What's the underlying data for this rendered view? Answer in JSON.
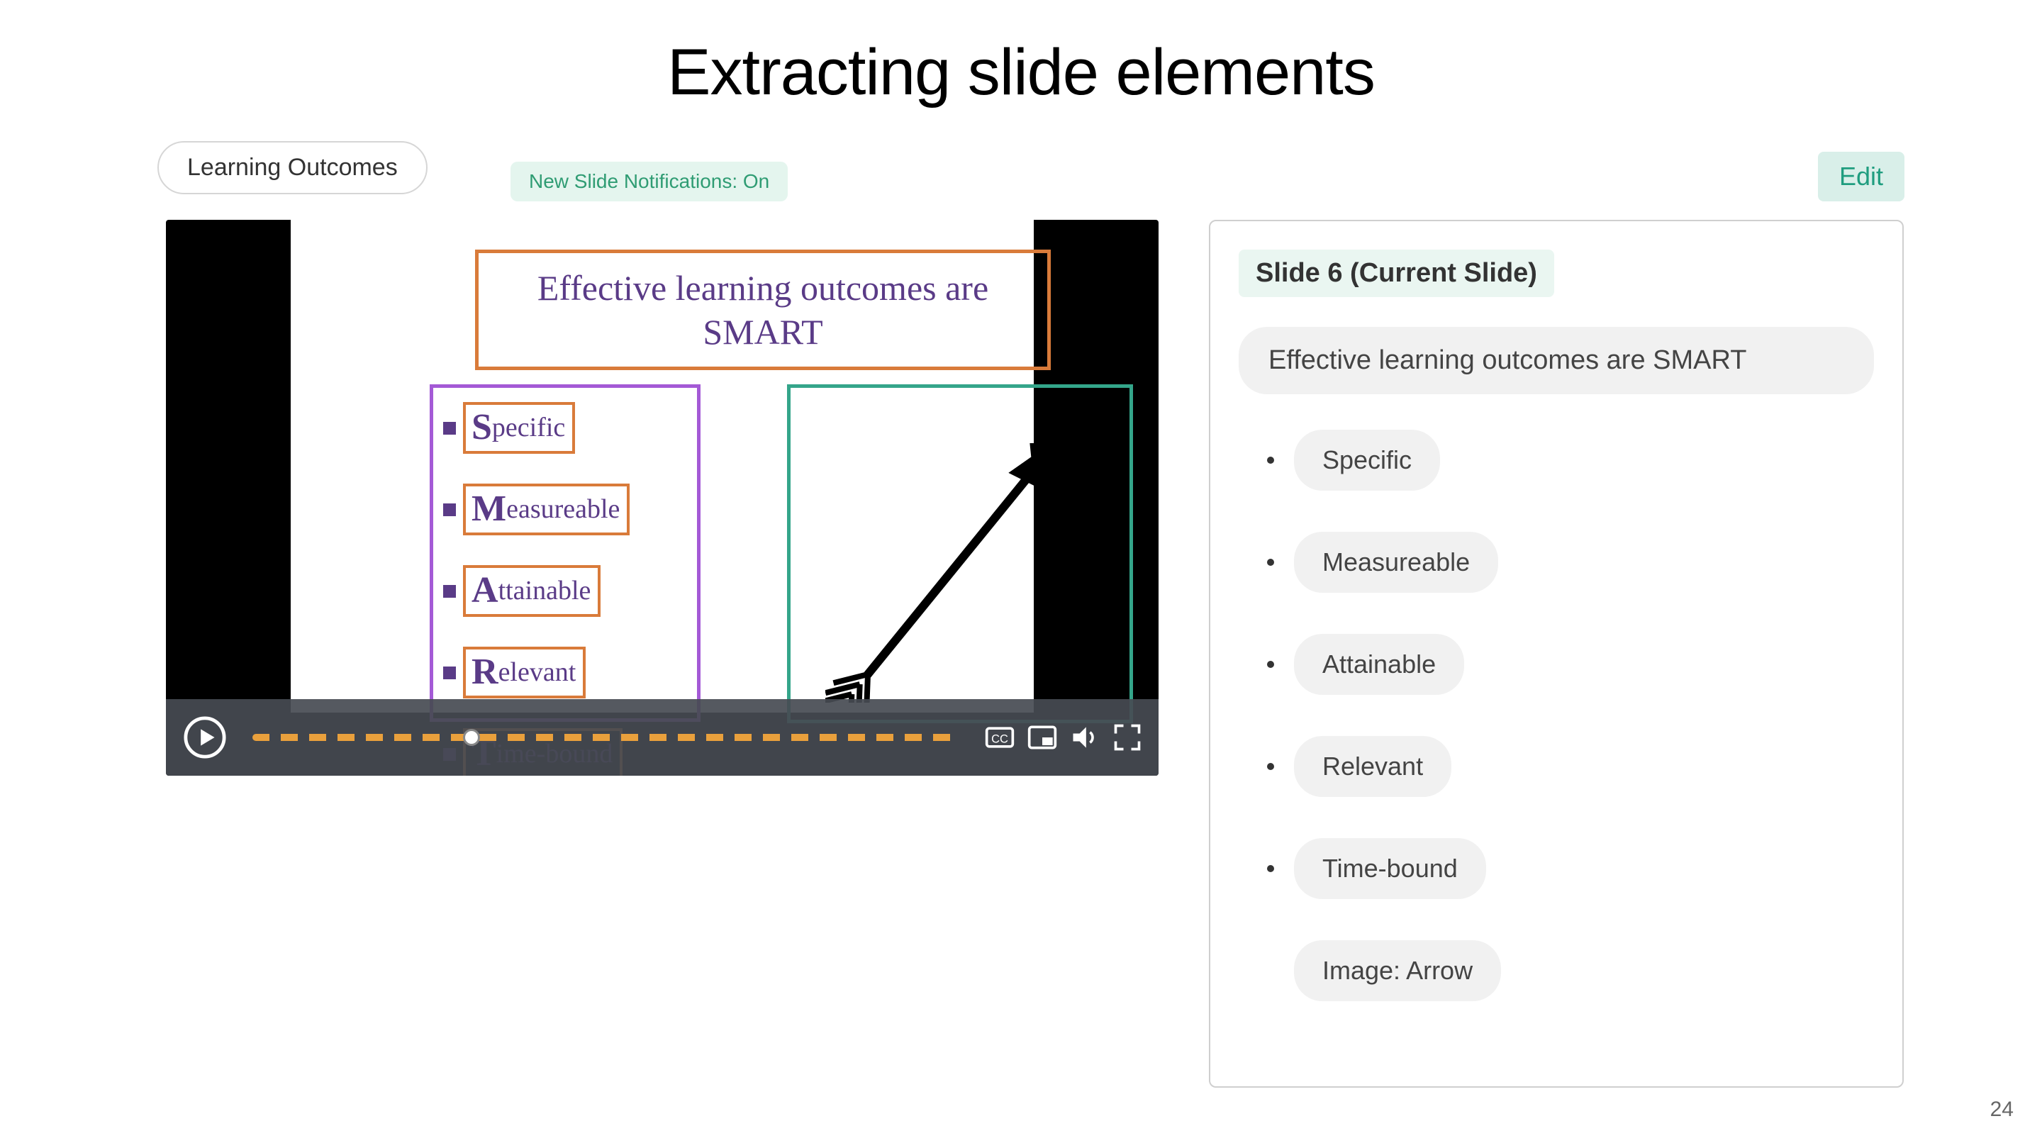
{
  "heading": "Extracting slide elements",
  "chip_outline": "Learning Outcomes",
  "chip_notifications": "New Slide Notifications: On",
  "edit_label": "Edit",
  "slide": {
    "title": "Effective learning outcomes are SMART",
    "items": [
      "Specific",
      "Measureable",
      "Attainable",
      "Relevant",
      "Time-bound"
    ],
    "image_label": "Arrow"
  },
  "panel": {
    "title": "Slide 6 (Current Slide)",
    "heading": "Effective learning outcomes are SMART",
    "bullets": [
      "Specific",
      "Measureable",
      "Attainable",
      "Relevant",
      "Time-bound"
    ],
    "image_item": "Image: Arrow"
  },
  "page_number": "24"
}
